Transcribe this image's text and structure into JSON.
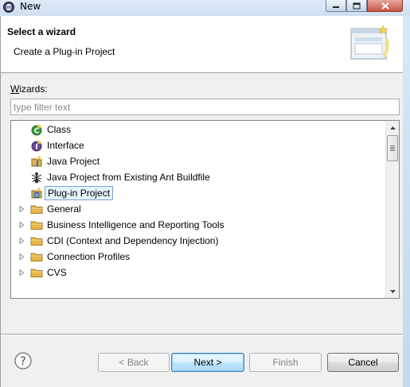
{
  "window": {
    "title": "New"
  },
  "banner": {
    "title": "Select a wizard",
    "description": "Create a Plug-in Project"
  },
  "wizards": {
    "label_mnemonic": "W",
    "label_rest": "izards:",
    "filter_placeholder": "type filter text",
    "filter_value": ""
  },
  "tree": {
    "items": [
      {
        "label": "Class",
        "icon": "java-class-icon",
        "expandable": false
      },
      {
        "label": "Interface",
        "icon": "java-interface-icon",
        "expandable": false
      },
      {
        "label": "Java Project",
        "icon": "java-project-icon",
        "expandable": false
      },
      {
        "label": "Java Project from Existing Ant Buildfile",
        "icon": "ant-icon",
        "expandable": false
      },
      {
        "label": "Plug-in Project",
        "icon": "plugin-project-icon",
        "expandable": false,
        "selected": true
      },
      {
        "label": "General",
        "icon": "folder-icon",
        "expandable": true
      },
      {
        "label": "Business Intelligence and Reporting Tools",
        "icon": "folder-icon",
        "expandable": true
      },
      {
        "label": "CDI (Context and Dependency Injection)",
        "icon": "folder-icon",
        "expandable": true
      },
      {
        "label": "Connection Profiles",
        "icon": "folder-icon",
        "expandable": true
      },
      {
        "label": "CVS",
        "icon": "folder-icon",
        "expandable": true
      }
    ]
  },
  "buttons": {
    "back": "< Back",
    "next": "Next >",
    "finish": "Finish",
    "cancel": "Cancel"
  },
  "colors": {
    "selection_bg": "#e5f3fb",
    "selection_border": "#7da2ce",
    "folder": "#e8b64c",
    "default_button_border": "#3c7fb1"
  }
}
